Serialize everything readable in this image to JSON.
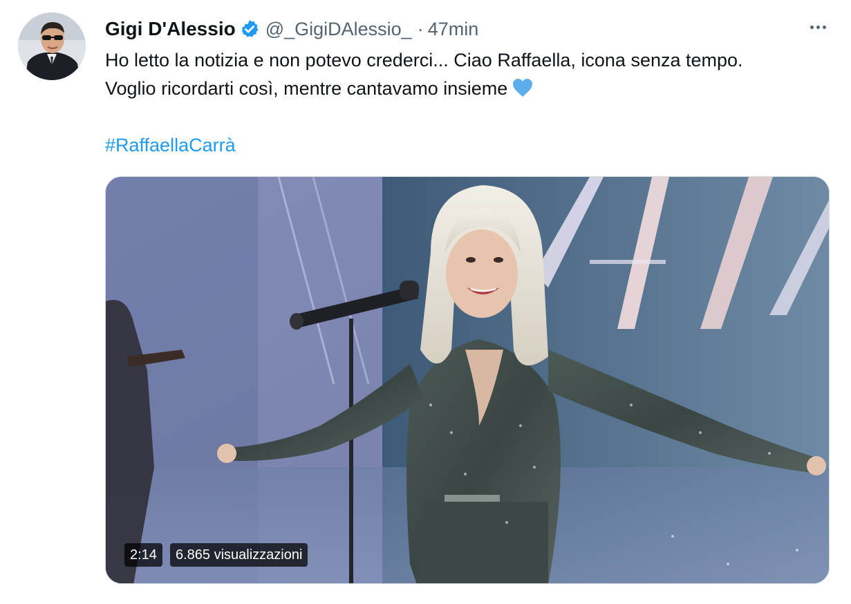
{
  "author": {
    "display_name": "Gigi D'Alessio",
    "handle": "@_GigiDAlessio_",
    "separator": "·",
    "time": "47min",
    "verified_icon": "verified-badge-icon",
    "avatar_icon": "avatar"
  },
  "tweet": {
    "lines": [
      "Ho letto la notizia e non potevo crederci... Ciao Raffaella, icona senza tempo.",
      "Voglio ricordarti così, mentre cantavamo insieme"
    ],
    "emoji": "blue-heart-icon",
    "hashtag": "#RaffaellaCarrà"
  },
  "media": {
    "type": "video",
    "duration": "2:14",
    "views": "6.865 visualizzazioni"
  },
  "actions": {
    "more_icon": "more-options-icon"
  },
  "colors": {
    "link": "#1d9bf0",
    "secondary_text": "#536471",
    "verified": "#1d9bf0",
    "heart": "#5dadec"
  }
}
